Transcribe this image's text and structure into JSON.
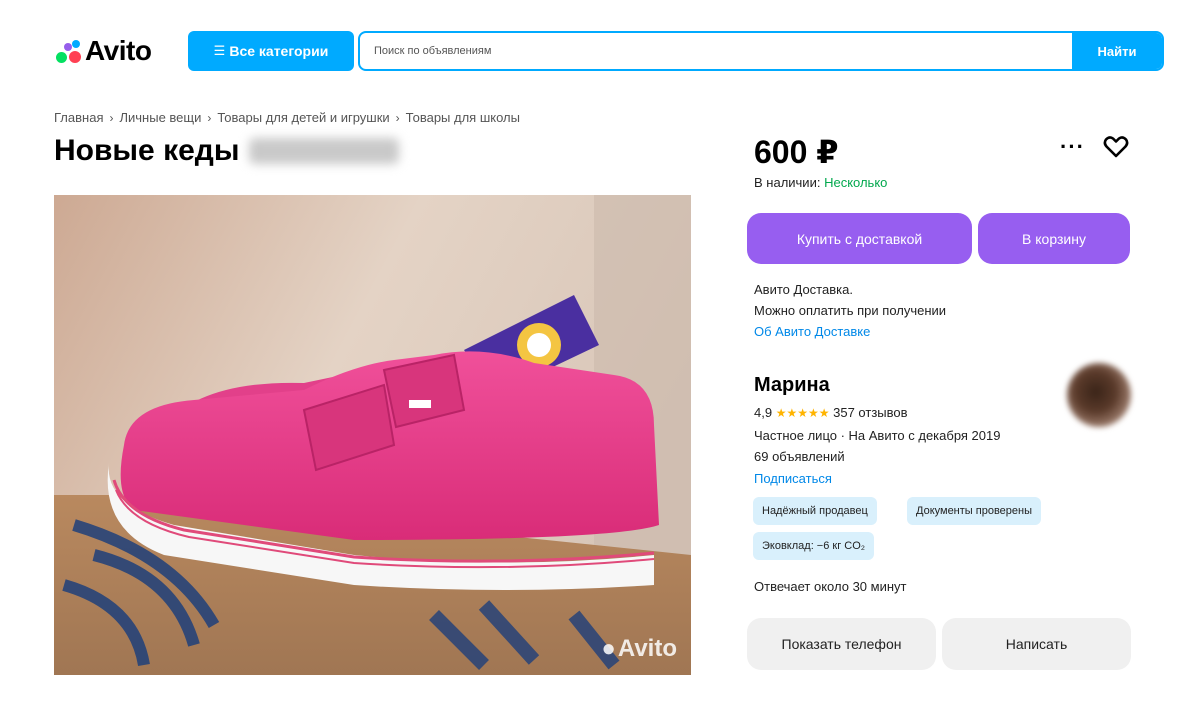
{
  "header": {
    "logo_text": "Avito",
    "categories_button": "Все категории",
    "search_placeholder": "Поиск по объявлениям",
    "search_button": "Найти"
  },
  "breadcrumb": [
    "Главная",
    "Личные вещи",
    "Товары для детей и игрушки",
    "Товары для школы"
  ],
  "listing": {
    "title": "Новые кеды",
    "price": "600 ₽",
    "availability_label": "В наличии:",
    "availability_value": "Несколько",
    "buy_button": "Купить с доставкой",
    "cart_button": "В корзину",
    "delivery_line1": "Авито Доставка.",
    "delivery_line2": "Можно оплатить при получении",
    "delivery_link": "Об Авито Доставке",
    "photo_watermark": "Avito"
  },
  "seller": {
    "name": "Марина",
    "rating": "4,9",
    "stars": "★★★★★",
    "reviews": "357 отзывов",
    "type_since": "Частное лицо · На Авито с декабря 2019",
    "listings": "69 объявлений",
    "subscribe": "Подписаться",
    "badges": [
      "Надёжный продавец",
      "Документы проверены",
      "Эковклад: −6 кг CO₂"
    ],
    "response_time": "Отвечает около 30 минут",
    "show_phone_button": "Показать телефон",
    "write_button": "Написать"
  },
  "colors": {
    "brand_blue": "#00aaff",
    "purple": "#975ef0",
    "green": "#02a84d",
    "link": "#0088e8",
    "badge_bg": "#d9f0fc",
    "star": "#ffb400"
  }
}
